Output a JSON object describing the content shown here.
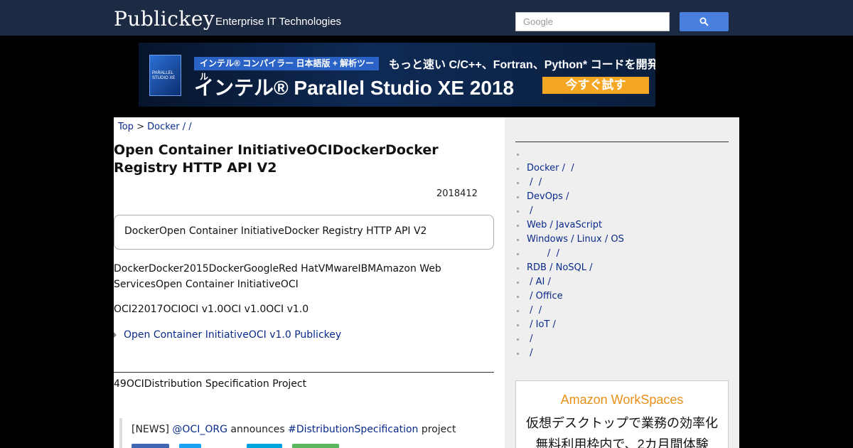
{
  "header": {
    "logo": "Publickey",
    "tagline": "Enterprise IT Technologies",
    "search_placeholder": "Google",
    "search_icon": "search-icon"
  },
  "banner": {
    "box_label": "PARALLEL STUDIO XE",
    "tag": "インテル® コンパイラー 日本語版 + 解析ツール",
    "copy": "もっと速い C/C++、Fortran、Python* コードを開発",
    "title": "インテル® Parallel Studio XE 2018",
    "cta": "今すぐ試す"
  },
  "breadcrumb": {
    "top": "Top",
    "sep": " > ",
    "category": "Docker /  /"
  },
  "article": {
    "title": "Open Container InitiativeOCIDockerDocker Registry HTTP API V2",
    "date": "2018412",
    "summary": "DockerOpen Container InitiativeDocker Registry HTTP API V2",
    "p1": "DockerDocker2015DockerGoogleRed HatVMwareIBMAmazon Web ServicesOpen Container InitiativeOCI",
    "p2": "OCI22017OCIOCI v1.0OCI v1.0OCI v1.0",
    "related": "Open Container InitiativeOCI v1.0  Publickey",
    "p3": "49OCIDistribution Specification Project"
  },
  "tweet": {
    "prefix": "[NEWS] ",
    "mention": "@OCI_ORG",
    "mid": " announces ",
    "hashtag": "#DistributionSpecification",
    "suffix": " project"
  },
  "sidebar": {
    "items": [
      "",
      "Docker /  /",
      " /  /",
      "DevOps /",
      " /",
      "Web / JavaScript",
      "Windows / Linux / OS",
      "       /  /",
      "RDB / NoSQL /",
      " / AI /",
      " / Office",
      " /  /",
      " / IoT /",
      " /",
      " /"
    ]
  },
  "ad": {
    "title": "Amazon WorkSpaces",
    "line1": "仮想デスクトップで業務の効率化",
    "line2": "無料利用枠内で、2カ月間体験"
  },
  "colors": {
    "header_bg": "#1c2a44",
    "link": "#0a2a8a",
    "search_button": "#4a7fe0",
    "cta": "#f5a623"
  }
}
